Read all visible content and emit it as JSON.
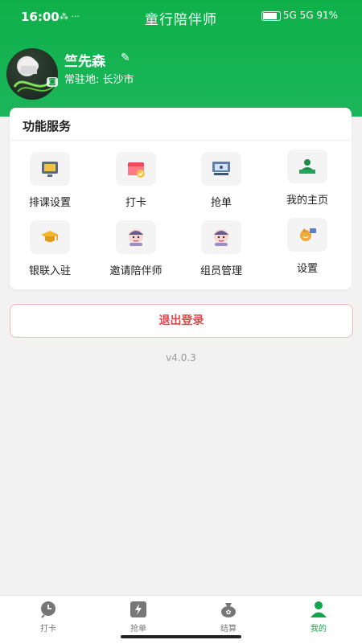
{
  "status_bar": {
    "time": "16:00",
    "extra_icons": "⁂ ···",
    "title": "童行陪伴师",
    "right": "5G 5G 91%"
  },
  "profile": {
    "name": "竺先森",
    "residence": "常驻地: 长沙市"
  },
  "services": {
    "title": "功能服务",
    "items": [
      {
        "label": "排课设置",
        "icon": "schedule-icon"
      },
      {
        "label": "打卡",
        "icon": "calendar-check-icon"
      },
      {
        "label": "抢单",
        "icon": "presentation-icon"
      },
      {
        "label": "我的主页",
        "icon": "user-podium-icon"
      },
      {
        "label": "银联入驻",
        "icon": "graduation-cap-icon"
      },
      {
        "label": "邀请陪伴师",
        "icon": "invite-avatar-icon"
      },
      {
        "label": "组员管理",
        "icon": "team-avatar-icon"
      },
      {
        "label": "设置",
        "icon": "settings-gift-icon"
      }
    ]
  },
  "logout_label": "退出登录",
  "version": "v4.0.3",
  "tabs": [
    {
      "label": "打卡",
      "icon": "clock-icon"
    },
    {
      "label": "抢单",
      "icon": "lightning-icon"
    },
    {
      "label": "结算",
      "icon": "money-bag-icon"
    },
    {
      "label": "我的",
      "icon": "person-icon"
    }
  ],
  "colors": {
    "brand_green": "#17b455",
    "logout_red": "#d84a4a",
    "active_tab": "#12a64c"
  }
}
